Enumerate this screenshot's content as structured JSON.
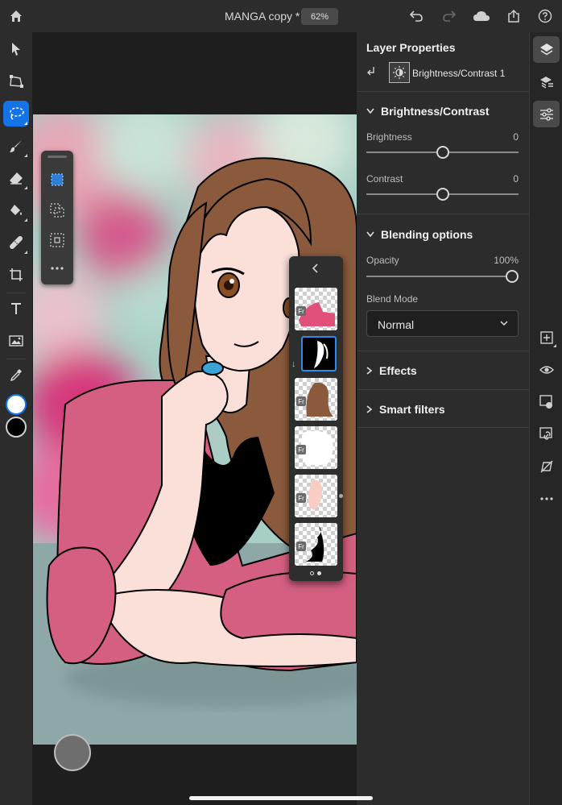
{
  "topbar": {
    "doc_title": "MANGA copy *",
    "zoom": "62%"
  },
  "props": {
    "title": "Layer Properties",
    "layer_name": "Brightness/Contrast 1",
    "sections": {
      "brightness_contrast": "Brightness/Contrast",
      "blending": "Blending options",
      "effects": "Effects",
      "smart_filters": "Smart filters"
    },
    "brightness": {
      "label": "Brightness",
      "value": "0",
      "fraction": 0.5
    },
    "contrast": {
      "label": "Contrast",
      "value": "0",
      "fraction": 0.5
    },
    "opacity": {
      "label": "Opacity",
      "value": "100%",
      "fraction": 1.0
    },
    "blend_mode": {
      "label": "Blend Mode",
      "value": "Normal"
    }
  },
  "layers": {
    "badge": "Fr",
    "items": [
      "layer-1",
      "adjustment-layer",
      "layer-hair",
      "layer-white",
      "layer-skin",
      "layer-black"
    ],
    "page_dots": 2,
    "current_page": 2
  },
  "colors": {
    "accent": "#1473e6",
    "hair": "#8b5a3c",
    "cardigan": "#d45f80",
    "skin": "#fbe0da",
    "table": "#8ea7a7"
  }
}
